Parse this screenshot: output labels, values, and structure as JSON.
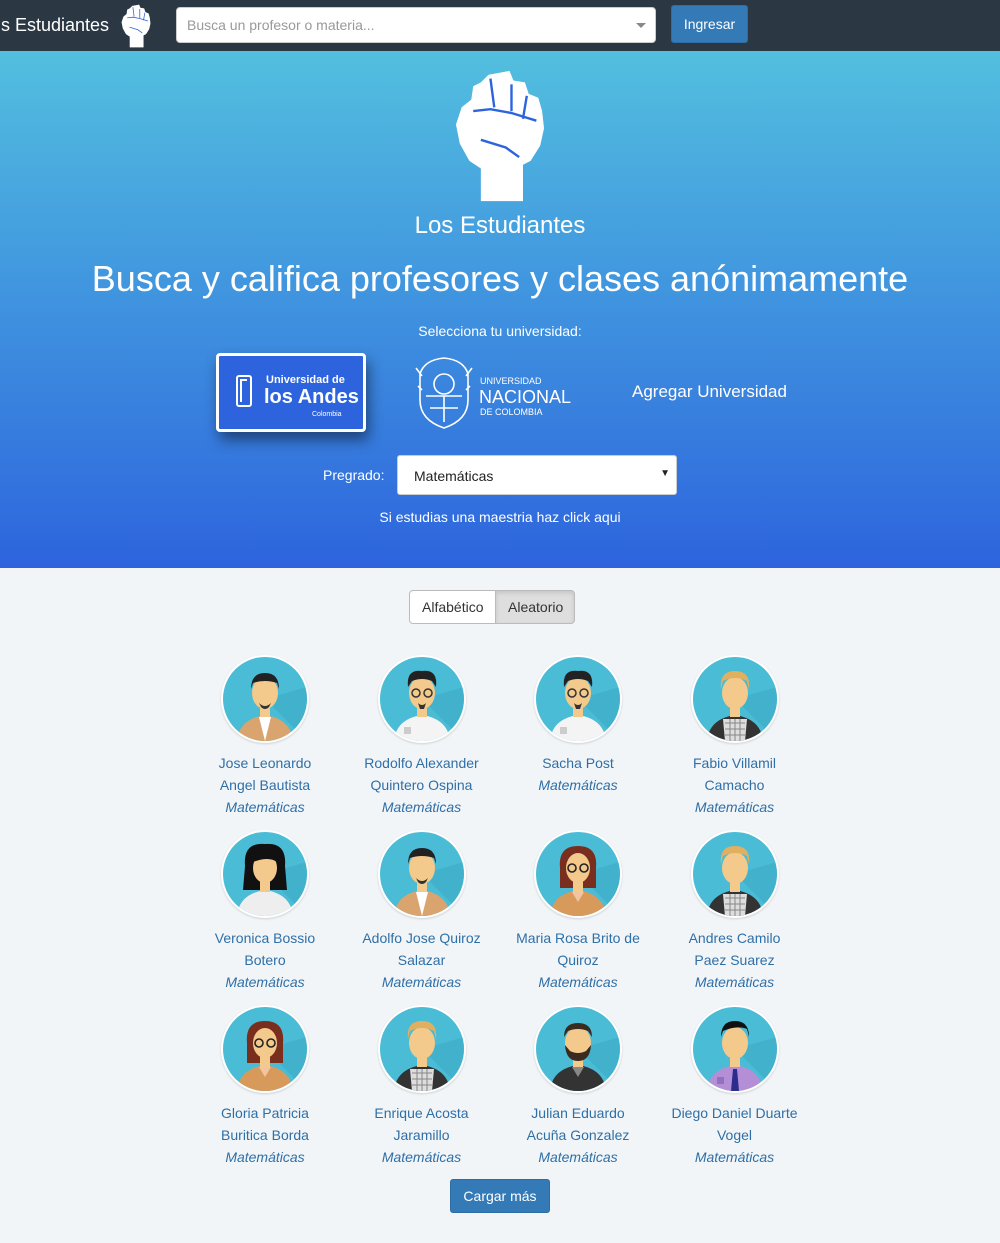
{
  "navbar": {
    "brand": "s Estudiantes",
    "search_placeholder": "Busca un profesor o materia...",
    "login_label": "Ingresar"
  },
  "hero": {
    "brand": "Los Estudiantes",
    "title": "Busca y califica profesores y clases anónimamente",
    "select_university_label": "Selecciona tu universidad:",
    "universities": [
      {
        "line1": "Universidad de",
        "line2": "los Andes",
        "line3": "Colombia",
        "selected": true
      },
      {
        "line1": "UNIVERSIDAD",
        "line2": "NACIONAL",
        "line3": "DE COLOMBIA",
        "selected": false
      }
    ],
    "add_university": "Agregar Universidad",
    "pregrado_label": "Pregrado:",
    "pregrado_value": "Matemáticas",
    "maestria_link": "Si estudias una maestria haz click aqui"
  },
  "sort": {
    "options": [
      "Alfabético",
      "Aleatorio"
    ],
    "active": "Aleatorio"
  },
  "professors": [
    {
      "line1": "Jose Leonardo",
      "line2": "Angel Bautista",
      "dept": "Matemáticas",
      "avatar": "man-beard-tan-shirt"
    },
    {
      "line1": "Rodolfo Alexander",
      "line2": "Quintero Ospina",
      "dept": "Matemáticas",
      "avatar": "man-glasses-white-shirt"
    },
    {
      "line1": "Sacha Post",
      "line2": "",
      "dept": "Matemáticas",
      "avatar": "man-glasses-white-shirt"
    },
    {
      "line1": "Fabio Villamil",
      "line2": "Camacho",
      "dept": "Matemáticas",
      "avatar": "man-blond-vest"
    },
    {
      "line1": "Veronica Bossio",
      "line2": "Botero",
      "dept": "Matemáticas",
      "avatar": "woman-black-hair"
    },
    {
      "line1": "Adolfo Jose Quiroz",
      "line2": "Salazar",
      "dept": "Matemáticas",
      "avatar": "man-beard-tan-shirt"
    },
    {
      "line1": "Maria Rosa Brito de",
      "line2": "Quiroz",
      "dept": "Matemáticas",
      "avatar": "woman-glasses-brown"
    },
    {
      "line1": "Andres Camilo",
      "line2": "Paez Suarez",
      "dept": "Matemáticas",
      "avatar": "man-blond-vest"
    },
    {
      "line1": "Gloria Patricia",
      "line2": "Buritica Borda",
      "dept": "Matemáticas",
      "avatar": "woman-glasses-brown"
    },
    {
      "line1": "Enrique Acosta",
      "line2": "Jaramillo",
      "dept": "Matemáticas",
      "avatar": "man-blond-vest"
    },
    {
      "line1": "Julian Eduardo",
      "line2": "Acuña Gonzalez",
      "dept": "Matemáticas",
      "avatar": "man-full-beard"
    },
    {
      "line1": "Diego Daniel Duarte",
      "line2": "Vogel",
      "dept": "Matemáticas",
      "avatar": "man-purple-shirt-tie"
    }
  ],
  "load_more_label": "Cargar más",
  "colors": {
    "navbar": "#2b3844",
    "hero_top": "#53bfdf",
    "hero_bottom": "#2d64dd",
    "link": "#2f6fa7",
    "button": "#337ab7",
    "avatar_bg": "#4bbcd6"
  }
}
